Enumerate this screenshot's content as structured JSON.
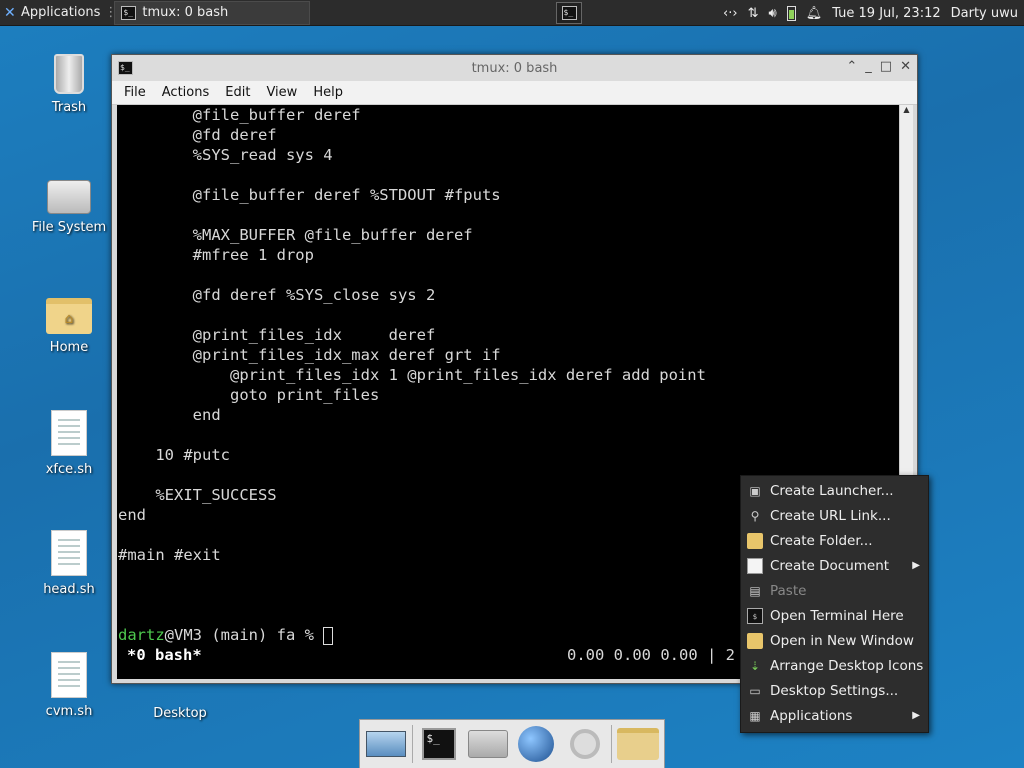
{
  "top_panel": {
    "applications_label": "Applications",
    "task_label": "tmux: 0 bash",
    "clock": "Tue 19 Jul, 23:12",
    "user": "Darty uwu"
  },
  "desktop_icons": [
    {
      "label": "Trash",
      "icon": "trash-icon"
    },
    {
      "label": "File System",
      "icon": "drive-icon"
    },
    {
      "label": "Home",
      "icon": "home-folder-icon"
    },
    {
      "label": "xfce.sh",
      "icon": "script-file-icon"
    },
    {
      "label": "head.sh",
      "icon": "script-file-icon"
    },
    {
      "label": "cvm.sh",
      "icon": "script-file-icon"
    },
    {
      "label": "Desktop",
      "icon": "folder-icon"
    }
  ],
  "window": {
    "title": "tmux: 0 bash",
    "menu": [
      "File",
      "Actions",
      "Edit",
      "View",
      "Help"
    ]
  },
  "terminal": {
    "lines": [
      "        @file_buffer deref",
      "        @fd deref",
      "        %SYS_read sys 4",
      "",
      "        @file_buffer deref %STDOUT #fputs",
      "",
      "        %MAX_BUFFER @file_buffer deref",
      "        #mfree 1 drop",
      "",
      "        @fd deref %SYS_close sys 2",
      "",
      "        @print_files_idx     deref",
      "        @print_files_idx_max deref grt if",
      "            @print_files_idx 1 @print_files_idx deref add point",
      "            goto print_files",
      "        end",
      "",
      "    10 #putc",
      "",
      "    %EXIT_SUCCESS",
      "end",
      "",
      "#main #exit"
    ],
    "prompt_user": "dartz",
    "prompt_rest": "@VM3 (main) fa % ",
    "status_left": "*0 bash*",
    "status_right": "0.00 0.00 0.00 | 2"
  },
  "context_menu": [
    {
      "label": "Create Launcher...",
      "icon": "launcher-icon",
      "disabled": false,
      "submenu": false
    },
    {
      "label": "Create URL Link...",
      "icon": "link-icon",
      "disabled": false,
      "submenu": false
    },
    {
      "label": "Create Folder...",
      "icon": "folder-icon",
      "disabled": false,
      "submenu": false
    },
    {
      "label": "Create Document",
      "icon": "document-icon",
      "disabled": false,
      "submenu": true
    },
    {
      "label": "Paste",
      "icon": "paste-icon",
      "disabled": true,
      "submenu": false
    },
    {
      "label": "Open Terminal Here",
      "icon": "terminal-icon",
      "disabled": false,
      "submenu": false
    },
    {
      "label": "Open in New Window",
      "icon": "folder-icon",
      "disabled": false,
      "submenu": false
    },
    {
      "label": "Arrange Desktop Icons",
      "icon": "arrange-icon",
      "disabled": false,
      "submenu": false
    },
    {
      "label": "Desktop Settings...",
      "icon": "monitor-icon",
      "disabled": false,
      "submenu": false
    },
    {
      "label": "Applications",
      "icon": "applications-icon",
      "disabled": false,
      "submenu": true
    }
  ],
  "dock": [
    "show-desktop-icon",
    "terminal-icon",
    "home-folder-icon",
    "web-browser-icon",
    "search-icon",
    "folder-icon"
  ]
}
